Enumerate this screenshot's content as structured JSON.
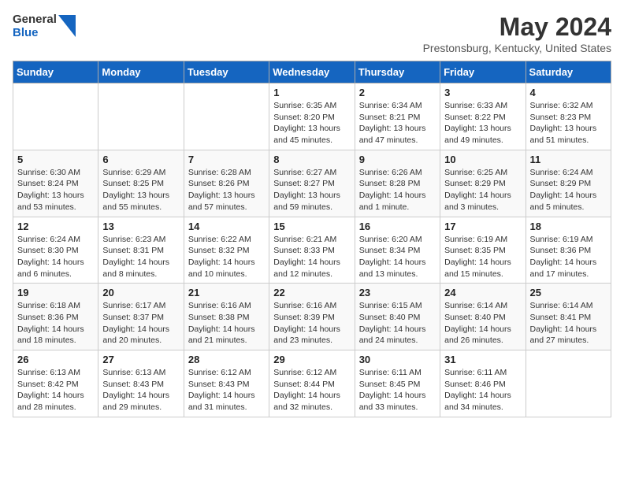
{
  "header": {
    "logo_general": "General",
    "logo_blue": "Blue",
    "month_title": "May 2024",
    "location": "Prestonsburg, Kentucky, United States"
  },
  "weekdays": [
    "Sunday",
    "Monday",
    "Tuesday",
    "Wednesday",
    "Thursday",
    "Friday",
    "Saturday"
  ],
  "weeks": [
    [
      {
        "day": "",
        "info": ""
      },
      {
        "day": "",
        "info": ""
      },
      {
        "day": "",
        "info": ""
      },
      {
        "day": "1",
        "info": "Sunrise: 6:35 AM\nSunset: 8:20 PM\nDaylight: 13 hours\nand 45 minutes."
      },
      {
        "day": "2",
        "info": "Sunrise: 6:34 AM\nSunset: 8:21 PM\nDaylight: 13 hours\nand 47 minutes."
      },
      {
        "day": "3",
        "info": "Sunrise: 6:33 AM\nSunset: 8:22 PM\nDaylight: 13 hours\nand 49 minutes."
      },
      {
        "day": "4",
        "info": "Sunrise: 6:32 AM\nSunset: 8:23 PM\nDaylight: 13 hours\nand 51 minutes."
      }
    ],
    [
      {
        "day": "5",
        "info": "Sunrise: 6:30 AM\nSunset: 8:24 PM\nDaylight: 13 hours\nand 53 minutes."
      },
      {
        "day": "6",
        "info": "Sunrise: 6:29 AM\nSunset: 8:25 PM\nDaylight: 13 hours\nand 55 minutes."
      },
      {
        "day": "7",
        "info": "Sunrise: 6:28 AM\nSunset: 8:26 PM\nDaylight: 13 hours\nand 57 minutes."
      },
      {
        "day": "8",
        "info": "Sunrise: 6:27 AM\nSunset: 8:27 PM\nDaylight: 13 hours\nand 59 minutes."
      },
      {
        "day": "9",
        "info": "Sunrise: 6:26 AM\nSunset: 8:28 PM\nDaylight: 14 hours\nand 1 minute."
      },
      {
        "day": "10",
        "info": "Sunrise: 6:25 AM\nSunset: 8:29 PM\nDaylight: 14 hours\nand 3 minutes."
      },
      {
        "day": "11",
        "info": "Sunrise: 6:24 AM\nSunset: 8:29 PM\nDaylight: 14 hours\nand 5 minutes."
      }
    ],
    [
      {
        "day": "12",
        "info": "Sunrise: 6:24 AM\nSunset: 8:30 PM\nDaylight: 14 hours\nand 6 minutes."
      },
      {
        "day": "13",
        "info": "Sunrise: 6:23 AM\nSunset: 8:31 PM\nDaylight: 14 hours\nand 8 minutes."
      },
      {
        "day": "14",
        "info": "Sunrise: 6:22 AM\nSunset: 8:32 PM\nDaylight: 14 hours\nand 10 minutes."
      },
      {
        "day": "15",
        "info": "Sunrise: 6:21 AM\nSunset: 8:33 PM\nDaylight: 14 hours\nand 12 minutes."
      },
      {
        "day": "16",
        "info": "Sunrise: 6:20 AM\nSunset: 8:34 PM\nDaylight: 14 hours\nand 13 minutes."
      },
      {
        "day": "17",
        "info": "Sunrise: 6:19 AM\nSunset: 8:35 PM\nDaylight: 14 hours\nand 15 minutes."
      },
      {
        "day": "18",
        "info": "Sunrise: 6:19 AM\nSunset: 8:36 PM\nDaylight: 14 hours\nand 17 minutes."
      }
    ],
    [
      {
        "day": "19",
        "info": "Sunrise: 6:18 AM\nSunset: 8:36 PM\nDaylight: 14 hours\nand 18 minutes."
      },
      {
        "day": "20",
        "info": "Sunrise: 6:17 AM\nSunset: 8:37 PM\nDaylight: 14 hours\nand 20 minutes."
      },
      {
        "day": "21",
        "info": "Sunrise: 6:16 AM\nSunset: 8:38 PM\nDaylight: 14 hours\nand 21 minutes."
      },
      {
        "day": "22",
        "info": "Sunrise: 6:16 AM\nSunset: 8:39 PM\nDaylight: 14 hours\nand 23 minutes."
      },
      {
        "day": "23",
        "info": "Sunrise: 6:15 AM\nSunset: 8:40 PM\nDaylight: 14 hours\nand 24 minutes."
      },
      {
        "day": "24",
        "info": "Sunrise: 6:14 AM\nSunset: 8:40 PM\nDaylight: 14 hours\nand 26 minutes."
      },
      {
        "day": "25",
        "info": "Sunrise: 6:14 AM\nSunset: 8:41 PM\nDaylight: 14 hours\nand 27 minutes."
      }
    ],
    [
      {
        "day": "26",
        "info": "Sunrise: 6:13 AM\nSunset: 8:42 PM\nDaylight: 14 hours\nand 28 minutes."
      },
      {
        "day": "27",
        "info": "Sunrise: 6:13 AM\nSunset: 8:43 PM\nDaylight: 14 hours\nand 29 minutes."
      },
      {
        "day": "28",
        "info": "Sunrise: 6:12 AM\nSunset: 8:43 PM\nDaylight: 14 hours\nand 31 minutes."
      },
      {
        "day": "29",
        "info": "Sunrise: 6:12 AM\nSunset: 8:44 PM\nDaylight: 14 hours\nand 32 minutes."
      },
      {
        "day": "30",
        "info": "Sunrise: 6:11 AM\nSunset: 8:45 PM\nDaylight: 14 hours\nand 33 minutes."
      },
      {
        "day": "31",
        "info": "Sunrise: 6:11 AM\nSunset: 8:46 PM\nDaylight: 14 hours\nand 34 minutes."
      },
      {
        "day": "",
        "info": ""
      }
    ]
  ]
}
